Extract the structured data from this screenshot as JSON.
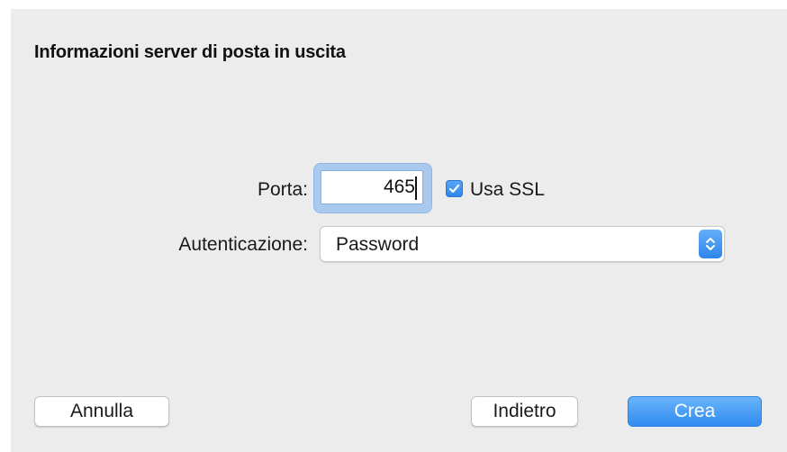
{
  "dialog": {
    "title": "Informazioni server di posta in uscita"
  },
  "form": {
    "port_label": "Porta:",
    "port_value": "465",
    "ssl_label": "Usa SSL",
    "ssl_checked": true,
    "auth_label": "Autenticazione:",
    "auth_value": "Password"
  },
  "buttons": {
    "cancel": "Annulla",
    "back": "Indietro",
    "create": "Crea"
  },
  "colors": {
    "accent": "#2f8cf0",
    "background": "#ececec"
  },
  "icons": {
    "checkbox": "checkmark-icon",
    "select": "up-down-chevron-icon"
  }
}
